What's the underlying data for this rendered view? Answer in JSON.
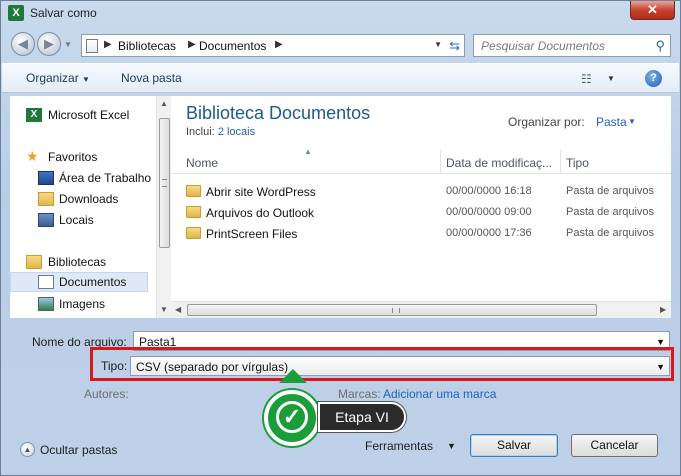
{
  "window": {
    "title": "Salvar como",
    "app_icon": "X",
    "close": "✕"
  },
  "address": {
    "breadcrumb": [
      "Bibliotecas",
      "Documentos"
    ]
  },
  "search": {
    "placeholder": "Pesquisar Documentos"
  },
  "toolbar": {
    "organize": "Organizar",
    "new_folder": "Nova pasta",
    "help": "?"
  },
  "navpane": {
    "items": [
      {
        "label": "Microsoft Excel",
        "icon": "excel-icon"
      },
      {
        "label": "Favoritos",
        "icon": "star-icon"
      },
      {
        "label": "Área de Trabalho",
        "icon": "desktop-icon"
      },
      {
        "label": "Downloads",
        "icon": "downloads-icon"
      },
      {
        "label": "Locais",
        "icon": "places-icon"
      },
      {
        "label": "Bibliotecas",
        "icon": "library-icon"
      },
      {
        "label": "Documentos",
        "icon": "documents-icon",
        "selected": true
      },
      {
        "label": "Imagens",
        "icon": "images-icon"
      }
    ]
  },
  "library": {
    "title": "Biblioteca Documentos",
    "includes_label": "Inclui:",
    "includes_link": "2 locais",
    "arrange_label": "Organizar por:",
    "arrange_value": "Pasta"
  },
  "columns": {
    "name": "Nome",
    "date": "Data de modificaç...",
    "type": "Tipo"
  },
  "files": [
    {
      "name": "Abrir site WordPress",
      "date": "00/00/0000 16:18",
      "type": "Pasta de arquivos"
    },
    {
      "name": "Arquivos do Outlook",
      "date": "00/00/0000 09:00",
      "type": "Pasta de arquivos"
    },
    {
      "name": "PrintScreen Files",
      "date": "00/00/0000 17:36",
      "type": "Pasta de arquivos"
    }
  ],
  "form": {
    "filename_label": "Nome do arquivo:",
    "filename_value": "Pasta1",
    "type_label": "Tipo:",
    "type_value": "CSV (separado por vírgulas)",
    "authors_label": "Autores:",
    "tags_label": "Marcas:",
    "tags_link": "Adicionar uma marca"
  },
  "footer": {
    "hide_folders": "Ocultar pastas",
    "tools": "Ferramentas",
    "save": "Salvar",
    "cancel": "Cancelar"
  },
  "callout": {
    "label": "Etapa VI",
    "color": "#1b9d3a",
    "highlight_color": "#d9171e"
  }
}
